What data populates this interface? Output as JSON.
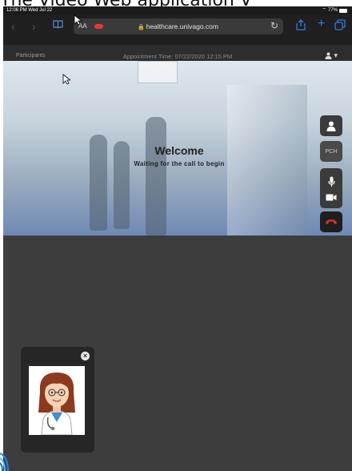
{
  "caption": "The Video Web application V",
  "statusbar": {
    "time": "12:06 PM  Wed Jul 22",
    "battery": "77%"
  },
  "browser": {
    "text_size": "AA",
    "url": "healthcare.univago.com",
    "icons": [
      "back-icon",
      "forward-icon",
      "book-icon",
      "reload-icon",
      "share-icon",
      "new-tab-icon",
      "tabs-icon"
    ]
  },
  "app": {
    "participants_label": "Participants",
    "appointment_time": "Appointment Time: 07/22/2020 12:15 PM"
  },
  "video": {
    "welcome_title": "Welcome",
    "welcome_subtitle": "Waiting for the call to begin"
  },
  "controls": {
    "pch_label": "PCH",
    "hangup_color": "#d0312d"
  },
  "accent_color": "#2f7de1"
}
